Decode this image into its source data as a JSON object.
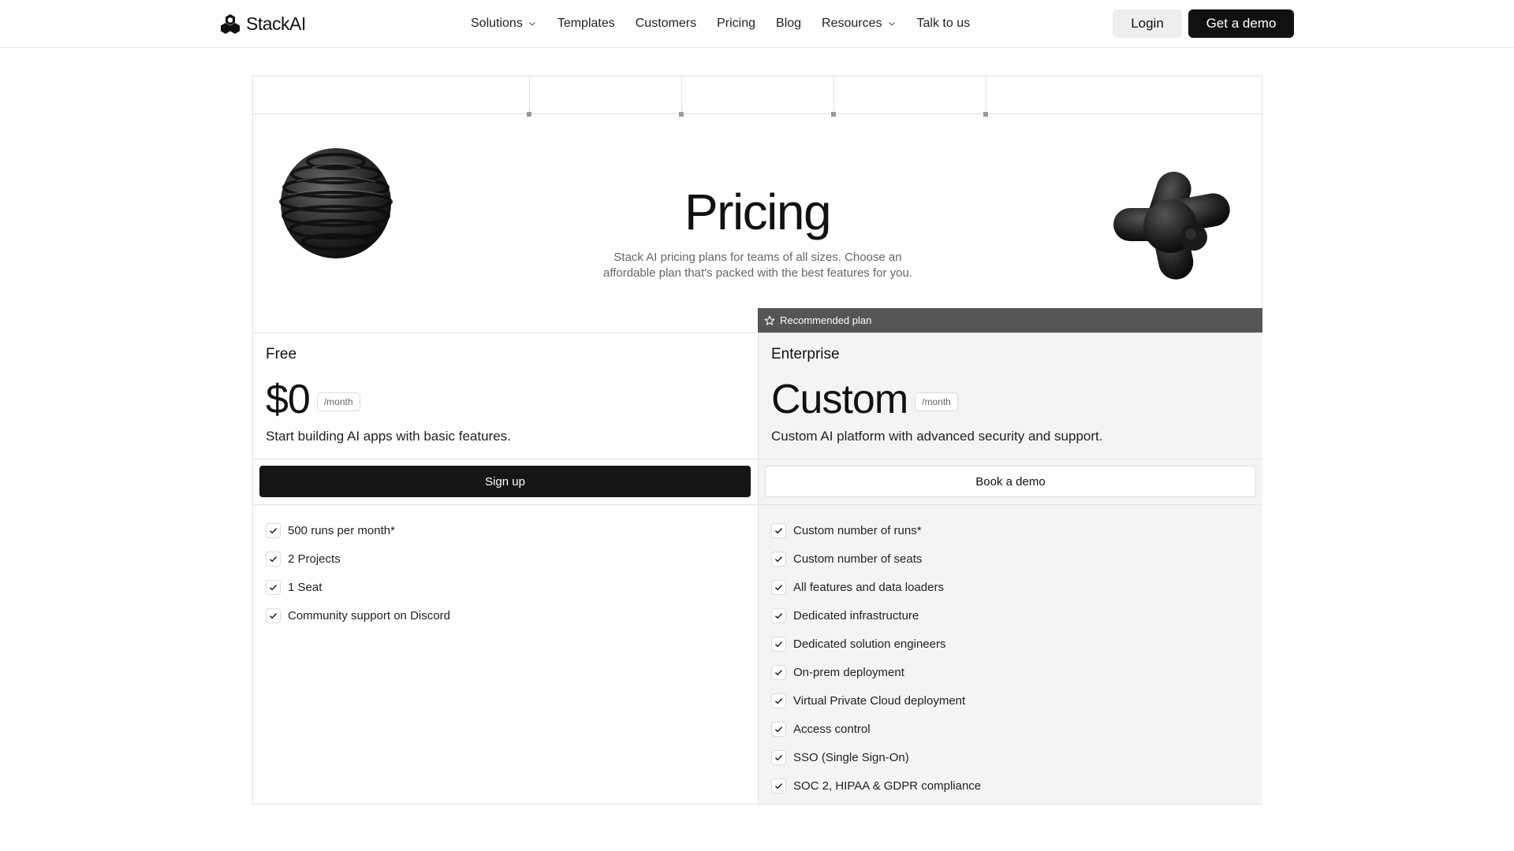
{
  "header": {
    "brand": "StackAI",
    "nav": [
      {
        "label": "Solutions",
        "dropdown": true
      },
      {
        "label": "Templates",
        "dropdown": false
      },
      {
        "label": "Customers",
        "dropdown": false
      },
      {
        "label": "Pricing",
        "dropdown": false
      },
      {
        "label": "Blog",
        "dropdown": false
      },
      {
        "label": "Resources",
        "dropdown": true
      },
      {
        "label": "Talk to us",
        "dropdown": false
      }
    ],
    "login_label": "Login",
    "demo_label": "Get a demo"
  },
  "hero": {
    "title": "Pricing",
    "subtitle": "Stack AI pricing plans for teams of all sizes. Choose an affordable plan that's packed with the best features for you.",
    "left_icon": "ribbed-sphere-3d-icon",
    "right_icon": "jack-shape-3d-icon"
  },
  "recommended": {
    "label": "Recommended plan",
    "icon": "star-icon"
  },
  "plans": {
    "free": {
      "name": "Free",
      "price": "$0",
      "period": "/month",
      "description": "Start building AI apps with basic features.",
      "cta": "Sign up",
      "features": [
        "500 runs per month*",
        "2 Projects",
        "1 Seat",
        "Community support on Discord"
      ]
    },
    "enterprise": {
      "name": "Enterprise",
      "price": "Custom",
      "period": "/month",
      "description": "Custom AI platform with advanced security and support.",
      "cta": "Book a demo",
      "features": [
        "Custom number of runs*",
        "Custom number of seats",
        "All features and data loaders",
        "Dedicated infrastructure",
        "Dedicated solution engineers",
        "On-prem deployment",
        "Virtual Private Cloud deployment",
        "Access control",
        "SSO (Single Sign-On)",
        "SOC 2, HIPAA & GDPR compliance"
      ]
    }
  },
  "colors": {
    "primary": "#111111",
    "recommended_bar": "#555555",
    "enterprise_bg": "#f4f4f4",
    "border": "#e2e2e2"
  }
}
